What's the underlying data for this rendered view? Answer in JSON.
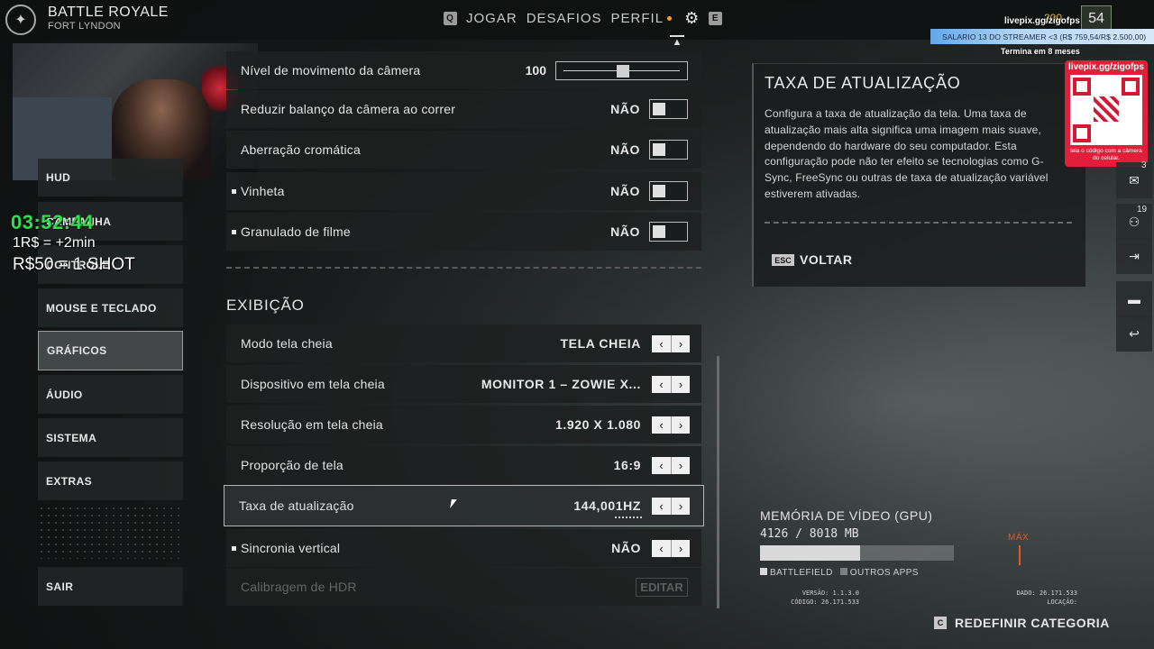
{
  "header": {
    "mode_title": "BATTLE ROYALE",
    "mode_subtitle": "FORT LYNDON",
    "nav_left_key": "Q",
    "nav_items": [
      "JOGAR",
      "DESAFIOS",
      "PERFIL"
    ],
    "nav_right_key": "E",
    "coins": "200",
    "level": "54"
  },
  "sidebar": {
    "items": [
      {
        "label": "HUD"
      },
      {
        "label": "CAMPANHA"
      },
      {
        "label": "CONTROLE"
      },
      {
        "label": "MOUSE E TECLADO"
      },
      {
        "label": "GRÁFICOS"
      },
      {
        "label": "ÁUDIO"
      },
      {
        "label": "SISTEMA"
      },
      {
        "label": "EXTRAS"
      }
    ],
    "exit_label": "SAIR"
  },
  "overlay": {
    "timer": "03:52:44",
    "promo_line1": "1R$ = +2min",
    "promo_line2": "R$50 = 1 SHOT",
    "livepix_top": "livepix.gg/zigofps",
    "salario": "SALARIO 13 DO STREAMER <3 (R$ 759,54/R$ 2.500,00)",
    "termina": "Termina em 8 meses",
    "qr_title": "livepix.gg/zigofps",
    "qr_footer": "leia o código com a câmera do celular."
  },
  "settings": {
    "rows_top": [
      {
        "label": "Nível de movimento da câmera",
        "value": "100",
        "kind": "slider",
        "level": 0.5
      },
      {
        "label": "Reduzir balanço da câmera ao correr",
        "value": "NÃO",
        "kind": "toggle"
      },
      {
        "label": "Aberração cromática",
        "value": "NÃO",
        "kind": "toggle"
      },
      {
        "label": "Vinheta",
        "value": "NÃO",
        "kind": "toggle"
      },
      {
        "label": "Granulado de filme",
        "value": "NÃO",
        "kind": "toggle"
      }
    ],
    "section_title": "EXIBIÇÃO",
    "rows_display": [
      {
        "label": "Modo tela cheia",
        "value": "TELA CHEIA"
      },
      {
        "label": "Dispositivo em tela cheia",
        "value": "MONITOR 1 – ZOWIE X..."
      },
      {
        "label": "Resolução em tela cheia",
        "value": "1.920 X 1.080"
      },
      {
        "label": "Proporção de tela",
        "value": "16:9"
      },
      {
        "label": "Taxa de atualização",
        "value": "144,001HZ"
      },
      {
        "label": "Sincronia vertical",
        "value": "NÃO"
      },
      {
        "label": "Calibragem de HDR",
        "value": "EDITAR"
      }
    ]
  },
  "description": {
    "title": "TAXA DE ATUALIZAÇÃO",
    "text": "Configura a taxa de atualização da tela. Uma taxa de atualização mais alta significa uma imagem mais suave, dependendo do hardware do seu computador. Esta configuração pode não ter efeito se tecnologias como G-Sync, FreeSync ou outras de taxa de atualização variável estiverem ativadas.",
    "back_key": "ESC",
    "back_label": "VOLTAR"
  },
  "right_icons": {
    "badge1": "3",
    "badge2": "19"
  },
  "gpu": {
    "title": "MEMÓRIA DE VÍDEO (GPU)",
    "value": "4126 / 8018 MB",
    "max_label": "MÁX",
    "battlefield_fraction": 0.514,
    "legend_battlefield": "BATTLEFIELD",
    "legend_other": "OUTROS APPS",
    "version_line": "VERSÃO: 1.1.3.0",
    "code_line": "CÓDIGO: 26.171.533",
    "data_line": "DADO: 26.171.533",
    "location_line": "LOCAÇÃO:"
  },
  "footer": {
    "reset_key": "C",
    "reset_label": "REDEFINIR CATEGORIA"
  }
}
